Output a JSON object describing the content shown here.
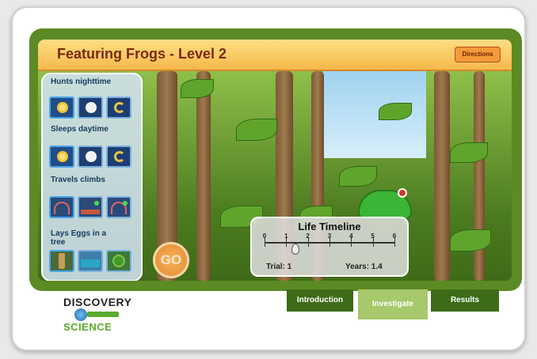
{
  "header": {
    "title": "Featuring Frogs - Level 2",
    "directions_label": "Directions"
  },
  "traits": [
    {
      "label": "Hunts nighttime",
      "options": [
        "hunts-option-1",
        "hunts-option-2",
        "hunts-option-3"
      ]
    },
    {
      "label": "Sleeps daytime",
      "options": [
        "sleeps-option-1",
        "sleeps-option-2",
        "sleeps-option-3"
      ]
    },
    {
      "label": "Travels climbs",
      "options": [
        "travels-option-1",
        "travels-option-2",
        "travels-option-3"
      ]
    },
    {
      "label": "Lays Eggs in a tree",
      "options": [
        "eggs-option-1",
        "eggs-option-2",
        "eggs-option-3"
      ]
    }
  ],
  "go_label": "GO",
  "timeline": {
    "title": "Life Timeline",
    "ticks": [
      "0",
      "1",
      "2",
      "3",
      "4",
      "5",
      "6"
    ],
    "trial_text": "Trial: 1",
    "years_text": "Years: 1.4",
    "marker_value": 1.4
  },
  "tabs": [
    {
      "label": "Introduction"
    },
    {
      "label": "Investigate"
    },
    {
      "label": "Results"
    }
  ],
  "logo": {
    "top": "DISCOVERY",
    "bottom": "SCIENCE"
  },
  "colors": {
    "frame": "#5c8a25",
    "header": "#f7b84a",
    "title": "#7a2a0c",
    "tab": "#3d6b18",
    "tab_active": "#a7c86b"
  }
}
